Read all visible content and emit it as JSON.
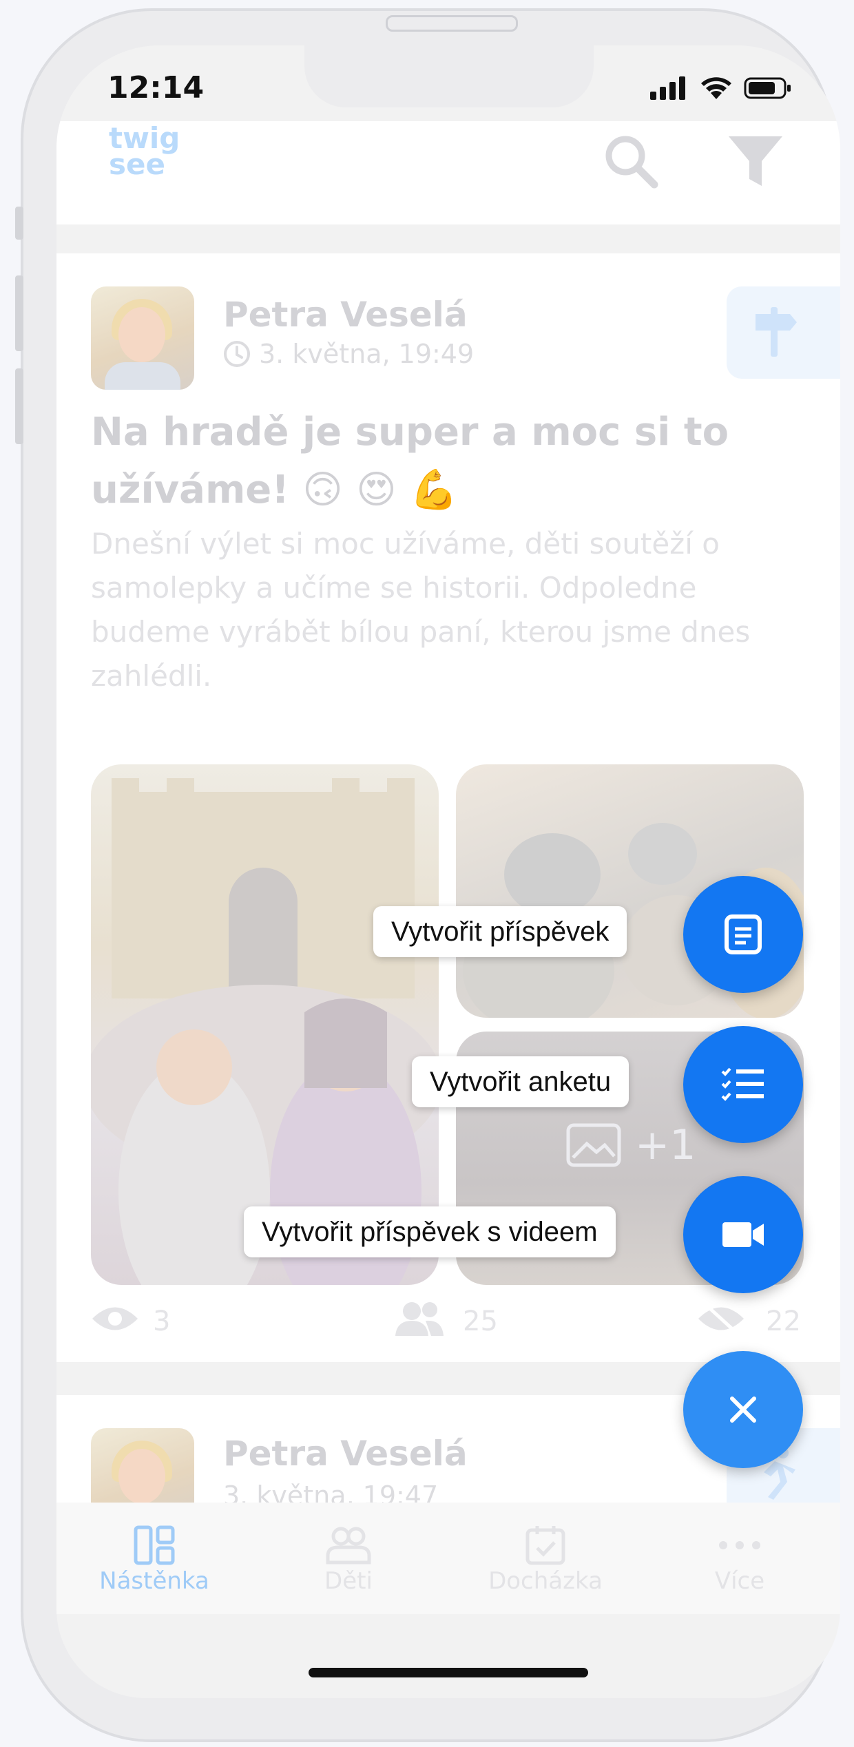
{
  "status_bar": {
    "time": "12:14"
  },
  "app": {
    "logo_line1": "twig",
    "logo_line2": "see"
  },
  "post": {
    "author": "Petra Veselá",
    "date": "3. května, 19:49",
    "title": "Na hradě je super a moc si to užíváme! 🙃 😍 💪",
    "body": "Dnešní výlet si moc užíváme, děti soutěží o samolepky a učíme se historii. Odpoledne budeme vyrábět bílou paní, kterou jsme dnes zahlédli.",
    "more_photos": "+1",
    "stats": {
      "views": "3",
      "recipients": "25",
      "unseen": "22"
    }
  },
  "post2": {
    "author": "Petra Veselá",
    "date": "3. května, 19:47"
  },
  "tabs": [
    {
      "label": "Nástěnka",
      "active": true,
      "icon": "dashboard-icon"
    },
    {
      "label": "Děti",
      "active": false,
      "icon": "children-icon"
    },
    {
      "label": "Docházka",
      "active": false,
      "icon": "calendar-check-icon"
    },
    {
      "label": "Více",
      "active": false,
      "icon": "more-icon"
    }
  ],
  "fab_menu": {
    "create_post": "Vytvořit příspěvek",
    "create_poll": "Vytvořit anketu",
    "create_video_post": "Vytvořit příspěvek s videem"
  },
  "colors": {
    "accent": "#1377f2",
    "tab_active": "#9fcbf7",
    "tab_inactive": "#e3e3e6"
  }
}
